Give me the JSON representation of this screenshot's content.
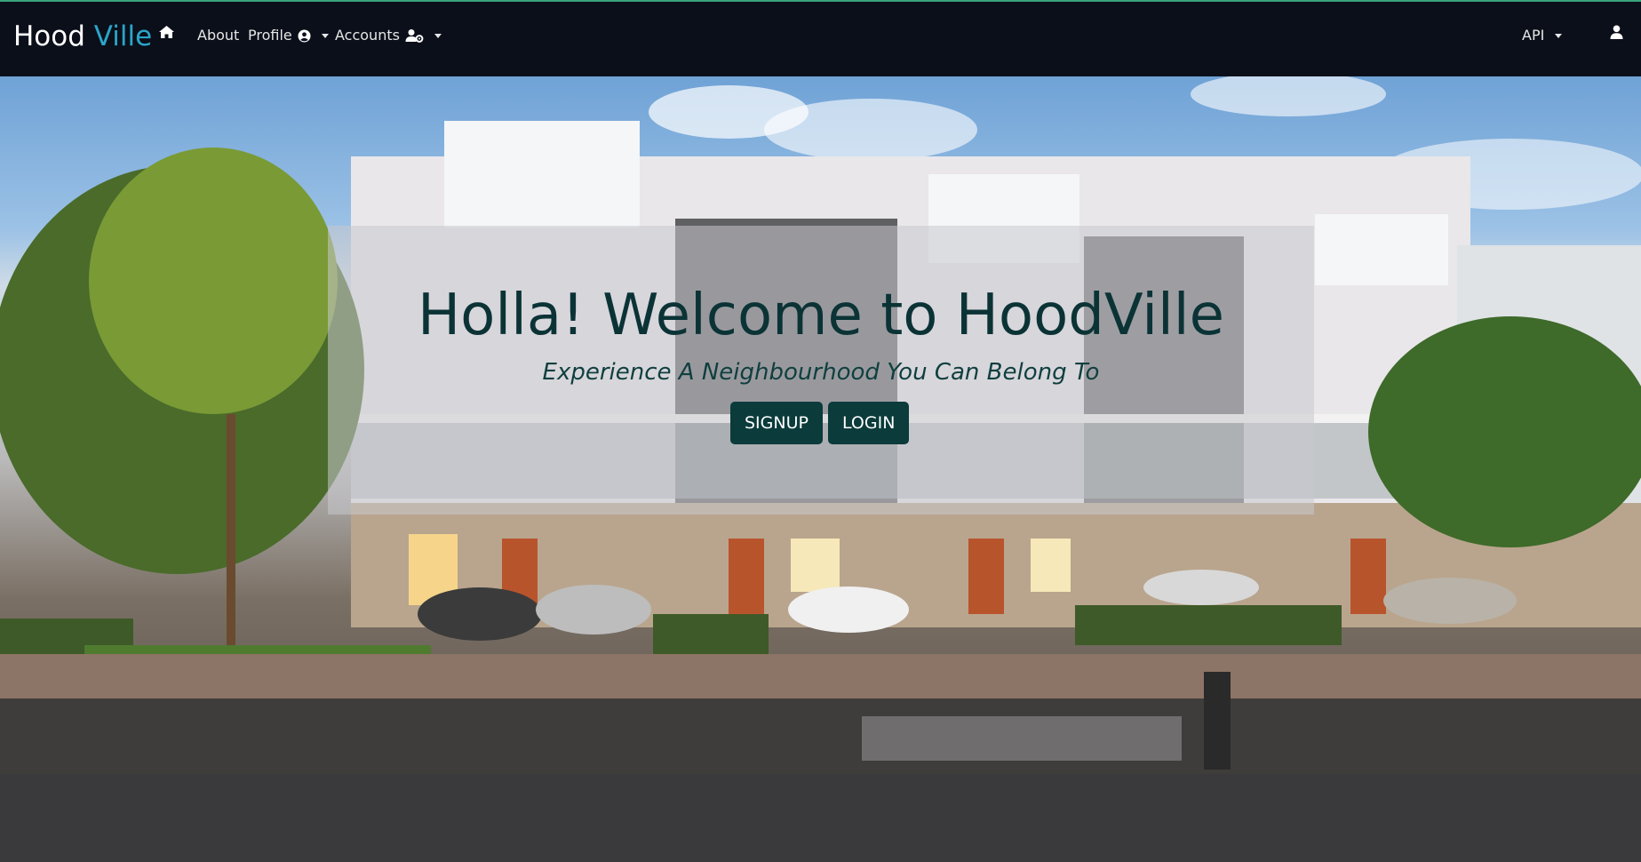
{
  "brand": {
    "part1": "Hood",
    "part2": "Ville"
  },
  "nav": {
    "home_icon": "home-icon",
    "about": "About",
    "profile": "Profile",
    "profile_icon": "user-circle-icon",
    "accounts": "Accounts",
    "accounts_icon": "user-cog-icon",
    "api": "API",
    "user_icon": "user-icon"
  },
  "hero": {
    "title": "Holla! Welcome to HoodVille",
    "subtitle": "Experience A Neighbourhood You Can Belong To",
    "signup": "SIGNUP",
    "login": "LOGIN"
  },
  "colors": {
    "navbar": "#0b0f1a",
    "brand_accent": "#2aa5c9",
    "button_bg": "#0b3b3b",
    "footer_bg": "#3a3a3c"
  }
}
